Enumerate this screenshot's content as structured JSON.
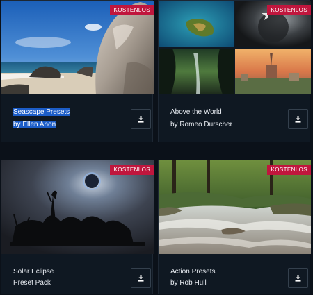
{
  "cards": [
    {
      "badge": "KOSTENLOS",
      "line1": "Seascape Presets",
      "line2": "by Ellen Anon",
      "image": "seascape-rocks-photo",
      "download_icon": "download-icon"
    },
    {
      "badge": "KOSTENLOS",
      "line1": "Above the World",
      "line2": "by Romeo Durscher",
      "image": "aerial-collage-photo",
      "download_icon": "download-icon"
    },
    {
      "badge": "KOSTENLOS",
      "line1": "Solar Eclipse",
      "line2": "Preset Pack",
      "image": "eclipse-statue-photo",
      "download_icon": "download-icon"
    },
    {
      "badge": "KOSTENLOS",
      "line1": "Action Presets",
      "line2": "by Rob Hull",
      "image": "forest-river-photo",
      "download_icon": "download-icon"
    }
  ],
  "colors": {
    "badge": "#c0163d",
    "background": "#0b1119",
    "selection": "#1c5dc8"
  }
}
